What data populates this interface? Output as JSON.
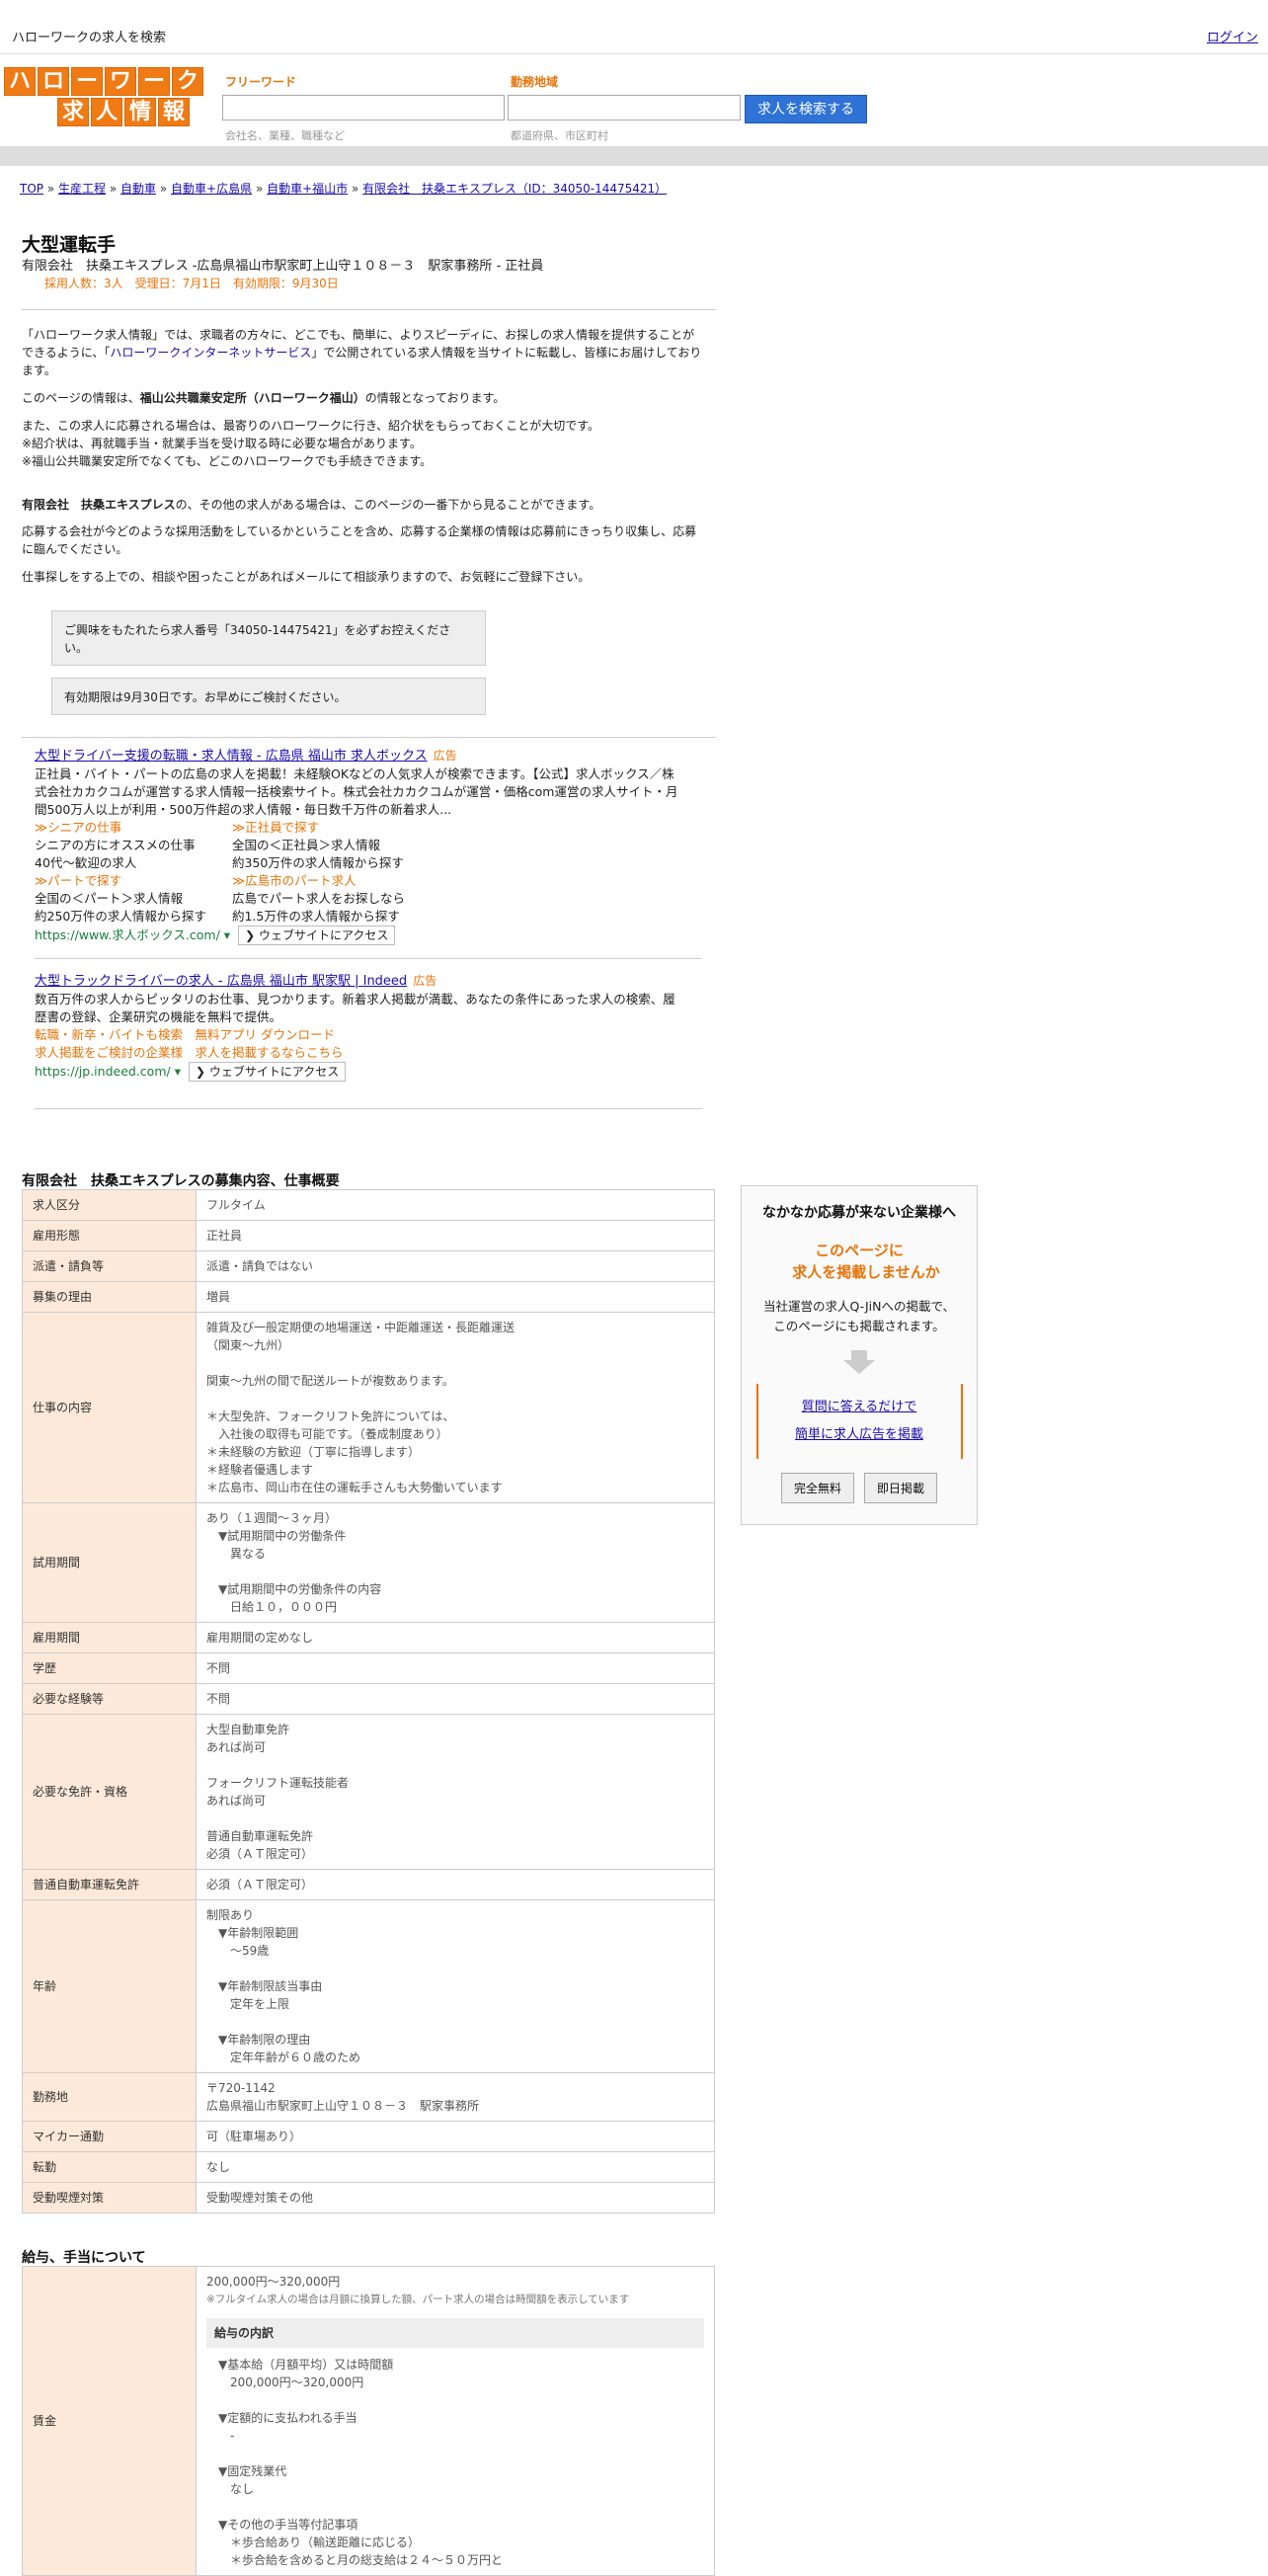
{
  "header": {
    "site_title": "ハローワークの求人を検索",
    "login": "ログイン"
  },
  "logo": {
    "row1": [
      "ハ",
      "ロ",
      "ー",
      "ワ",
      "ー",
      "ク"
    ],
    "row2": [
      "求",
      "人",
      "情",
      "報"
    ]
  },
  "search": {
    "freeword_label": "フリーワード",
    "freeword_hint": "会社名、業種、職種など",
    "area_label": "勤務地域",
    "area_hint": "都道府県、市区町村",
    "button": "求人を検索する"
  },
  "breadcrumb": [
    "TOP",
    "生産工程",
    "自動車",
    "自動車+広島県",
    "自動車+福山市",
    "有限会社　扶桑エキスプレス（ID：34050-14475421）"
  ],
  "breadcrumb_sep": "»",
  "job": {
    "title": "大型運転手",
    "company_line": "有限会社　扶桑エキスプレス -広島県福山市駅家町上山守１０８－３　駅家事務所 - 正社員",
    "meta": "採用人数：3人　受理日：7月1日　有効期限：9月30日"
  },
  "intro": {
    "p1_a": "「ハローワーク求人情報」では、求職者の方々に、どこでも、簡単に、よりスピーディに、お探しの求人情報を提供することができるように、「",
    "p1_link": "ハローワークインターネットサービス",
    "p1_b": "」で公開されている求人情報を当サイトに転載し、皆様にお届けしております。",
    "p2_a": "このページの情報は、",
    "p2_bold": "福山公共職業安定所（ハローワーク福山）",
    "p2_b": "の情報となっております。",
    "p3": "また、この求人に応募される場合は、最寄りのハローワークに行き、紹介状をもらっておくことが大切です。\n※紹介状は、再就職手当・就業手当を受け取る時に必要な場合があります。\n※福山公共職業安定所でなくても、どこのハローワークでも手続きできます。",
    "p4_bold": "有限会社　扶桑エキスプレス",
    "p4_b": "の、その他の求人がある場合は、このページの一番下から見ることができます。",
    "p5": "応募する会社が今どのような採用活動をしているかということを含め、応募する企業様の情報は応募前にきっちり収集し、応募に臨んでください。",
    "p6": "仕事探しをする上での、相談や困ったことがあればメールにて相談承りますので、お気軽にご登録下さい。",
    "note1": "ご興味をもたれたら求人番号「34050-14475421」を必ずお控えください。",
    "note2": "有効期限は9月30日です。お早めにご検討ください。"
  },
  "ads": [
    {
      "title": "大型ドライバー支援の転職・求人情報 - 広島県 福山市 求人ボックス",
      "badge": "広告",
      "desc": "正社員・バイト・パートの広島の求人を掲載！未経験OKなどの人気求人が検索できます。【公式】求人ボックス／株式会社カカクコムが運営する求人情報一括検索サイト。株式会社カカクコムが運営・価格com運営の求人サイト・月間500万人以上が利用・500万件超の求人情報・毎日数千万件の新着求人...",
      "sitelinks": [
        {
          "title": "≫シニアの仕事",
          "l1": "シニアの方にオススメの仕事",
          "l2": "40代～歓迎の求人"
        },
        {
          "title": "≫正社員で探す",
          "l1": "全国の＜正社員＞求人情報",
          "l2": "約350万件の求人情報から探す"
        },
        {
          "title": "≫パートで探す",
          "l1": "全国の＜パート＞求人情報",
          "l2": "約250万件の求人情報から探す"
        },
        {
          "title": "≫広島市のパート求人",
          "l1": "広島でパート求人をお探しなら",
          "l2": "約1.5万件の求人情報から探す"
        }
      ],
      "url": "https://www.求人ボックス.com/",
      "visit": "ウェブサイトにアクセス"
    },
    {
      "title": "大型トラックドライバーの求人 - 広島県 福山市 駅家駅 | Indeed",
      "badge": "広告",
      "desc": "数百万件の求人からピッタリのお仕事、見つかります。新着求人掲載が満載、あなたの条件にあった求人の検索、履歴書の登録、企業研究の機能を無料で提供。",
      "sub1": "転職・新卒・バイトも検索　無料アプリ ダウンロード",
      "sub2": "求人掲載をご検討の企業様　求人を掲載するならこちら",
      "url": "https://jp.indeed.com/",
      "visit": "ウェブサイトにアクセス"
    }
  ],
  "details": {
    "title": "有限会社　扶桑エキスプレスの募集内容、仕事概要",
    "rows": [
      {
        "label": "求人区分",
        "value": "フルタイム"
      },
      {
        "label": "雇用形態",
        "value": "正社員"
      },
      {
        "label": "派遣・請負等",
        "value": "派遣・請負ではない"
      },
      {
        "label": "募集の理由",
        "value": "増員"
      },
      {
        "label": "仕事の内容",
        "value": "雑貨及び一般定期便の地場運送・中距離運送・長距離運送\n（関東～九州）\n\n関東～九州の間で配送ルートが複数あります。\n\n＊大型免許、フォークリフト免許については、\n　入社後の取得も可能です。（養成制度あり）\n＊未経験の方歓迎（丁寧に指導します）\n＊経験者優遇します\n＊広島市、岡山市在住の運転手さんも大勢働いています"
      },
      {
        "label": "試用期間",
        "value": "あり（１週間～３ヶ月）\n　▼試用期間中の労働条件\n　　異なる\n\n　▼試用期間中の労働条件の内容\n　　日給１０，０００円"
      },
      {
        "label": "雇用期間",
        "value": "雇用期間の定めなし"
      },
      {
        "label": "学歴",
        "value": "不問"
      },
      {
        "label": "必要な経験等",
        "value": "不問"
      },
      {
        "label": "必要な免許・資格",
        "value": "大型自動車免許\nあれば尚可\n\nフォークリフト運転技能者\nあれば尚可\n\n普通自動車運転免許\n必須（ＡＴ限定可）"
      },
      {
        "label": "普通自動車運転免許",
        "value": "必須（ＡＴ限定可）"
      },
      {
        "label": "年齢",
        "value": "制限あり\n　▼年齢制限範囲\n　　～59歳\n\n　▼年齢制限該当事由\n　　定年を上限\n\n　▼年齢制限の理由\n　　定年年齢が６０歳のため"
      },
      {
        "label": "勤務地",
        "value": "〒720-1142\n広島県福山市駅家町上山守１０８－３　駅家事務所"
      },
      {
        "label": "マイカー通勤",
        "value": "可（駐車場あり）"
      },
      {
        "label": "転勤",
        "value": "なし"
      },
      {
        "label": "受動喫煙対策",
        "value": "受動喫煙対策その他"
      }
    ]
  },
  "salary": {
    "title": "給与、手当について",
    "label": "賃金",
    "range": "200,000円〜320,000円",
    "note": "※フルタイム求人の場合は月額に換算した額、パート求人の場合は時間額を表示しています",
    "sub_title": "給与の内訳",
    "body": "　▼基本給（月額平均）又は時間額\n　　200,000円〜320,000円\n\n　▼定額的に支払われる手当\n　　-\n\n　▼固定残業代\n　　なし\n\n　▼その他の手当等付記事項\n　　＊歩合給あり（輸送距離に応じる）\n　　＊歩合給を含めると月の総支給は２４～５０万円と"
  },
  "sidebar": {
    "title": "なかなか応募が来ない企業様へ",
    "headline1": "このページに",
    "headline2": "求人を掲載しませんか",
    "text1": "当社運営の求人Q-JiNへの掲載で、",
    "text2": "このページにも掲載されます。",
    "link1": "質問に答えるだけで",
    "link2": "簡単に求人広告を掲載",
    "btn1": "完全無料",
    "btn2": "即日掲載"
  }
}
